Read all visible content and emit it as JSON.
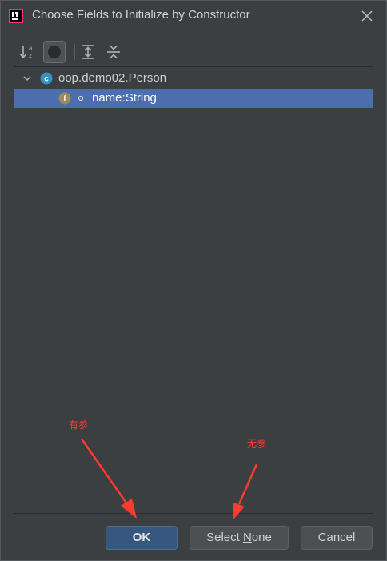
{
  "window": {
    "title": "Choose Fields to Initialize by Constructor"
  },
  "toolbar": {
    "buttons": [
      {
        "icon": "sort-alphabetically-icon"
      },
      {
        "icon": "show-classes-icon"
      },
      {
        "icon": "expand-all-icon"
      },
      {
        "icon": "collapse-all-icon"
      }
    ]
  },
  "tree": {
    "class_node": {
      "badge": "c",
      "label": "oop.demo02.Person",
      "expanded": true
    },
    "field_node": {
      "badge": "f",
      "label": "name:String",
      "selected": true
    }
  },
  "annotations": {
    "ok_note": "有参",
    "select_none_note": "无参",
    "color": "#ff3b30"
  },
  "buttons": {
    "ok": "OK",
    "select_none_prefix": "Select ",
    "select_none_mnemonic": "N",
    "select_none_suffix": "one",
    "cancel": "Cancel"
  },
  "colors": {
    "background": "#3c3f41",
    "selection": "#4b6eaf",
    "primary_button": "#365880"
  }
}
